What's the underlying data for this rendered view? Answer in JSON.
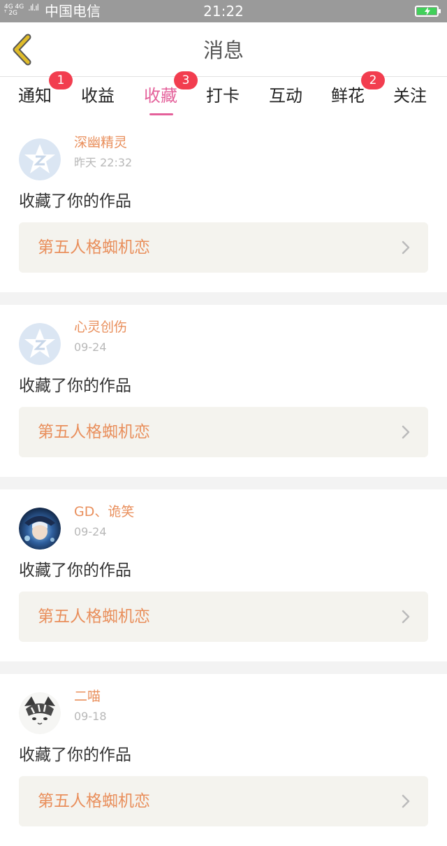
{
  "status_bar": {
    "network_top": "4G 4G",
    "network_bottom": "ᵀ 2G",
    "signal_bars": ".ıl.ıl",
    "carrier": "中国电信",
    "time": "21:22"
  },
  "nav": {
    "title": "消息",
    "back_icon": "chevron-left-icon",
    "back_color": "#e0bc2a"
  },
  "tabs": [
    {
      "label": "通知",
      "badge": "1"
    },
    {
      "label": "收益",
      "badge": ""
    },
    {
      "label": "收藏",
      "badge": "3",
      "active": true
    },
    {
      "label": "打卡",
      "badge": ""
    },
    {
      "label": "互动",
      "badge": ""
    },
    {
      "label": "鲜花",
      "badge": "2"
    },
    {
      "label": "关注",
      "badge": ""
    }
  ],
  "messages": [
    {
      "username": "深幽精灵",
      "time": "昨天 22:32",
      "action": "收藏了你的作品",
      "work_title": "第五人格蜘机恋",
      "avatar": "default-avatar-icon"
    },
    {
      "username": "心灵创伤",
      "time": "09-24",
      "action": "收藏了你的作品",
      "work_title": "第五人格蜘机恋",
      "avatar": "default-avatar-icon"
    },
    {
      "username": "GD、诡笑",
      "time": "09-24",
      "action": "收藏了你的作品",
      "work_title": "第五人格蜘机恋",
      "avatar": "anime-avatar-image"
    },
    {
      "username": "二喵",
      "time": "09-18",
      "action": "收藏了你的作品",
      "work_title": "第五人格蜘机恋",
      "avatar": "cat-avatar-image"
    }
  ],
  "colors": {
    "accent_pink": "#e4609a",
    "username_orange": "#e98f5c",
    "badge_red": "#f23d4f",
    "statusbar_gray": "#9a9a9a"
  }
}
